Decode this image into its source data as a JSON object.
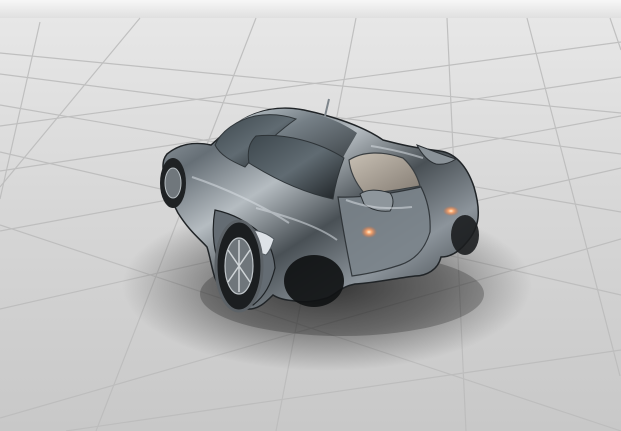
{
  "scene": {
    "subject": "car-render",
    "colors": {
      "sky": "#f2f2f2",
      "floor": "#d4d4d4",
      "grid_line": "#bdbdbd",
      "car_body": "#5f676d",
      "car_highlight": "#c9d0d6",
      "car_shadow": "#1f2326",
      "tail_light": "#f3a26f"
    }
  }
}
